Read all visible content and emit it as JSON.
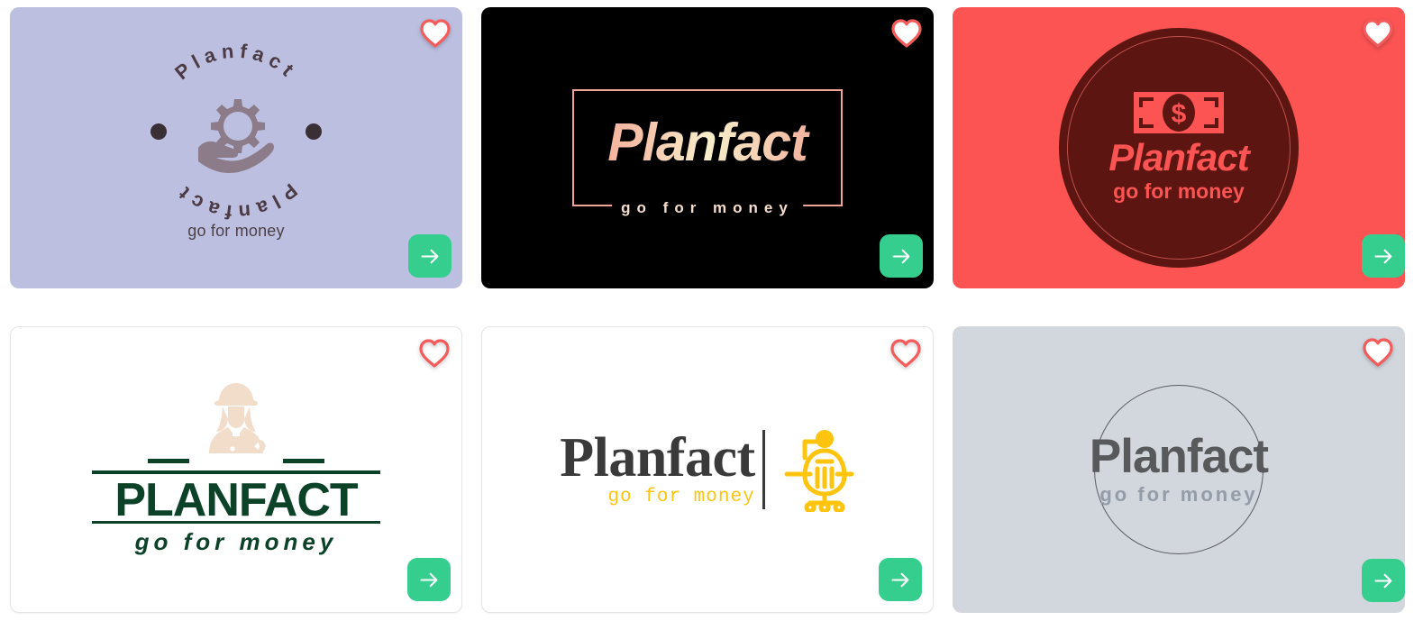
{
  "page": {
    "background": "#ffffff",
    "accent_green": "#36ce8f",
    "heart_stroke": "#f45b5b"
  },
  "controls": {
    "favorite_label": "heart-icon",
    "next_label": "arrow-right-icon"
  },
  "cards": [
    {
      "id": "card-circular-gear",
      "brand": "Planfact",
      "tagline": "go for money",
      "background": "#bcbfe0",
      "text_color": "#4c4149",
      "icon": "gear-in-hand-icon",
      "favorited": true,
      "arc_top_text": "Planfact",
      "arc_bottom_text": "Planfact"
    },
    {
      "id": "card-black-gradient-frame",
      "brand": "Planfact",
      "tagline": "go for money",
      "background": "#000000",
      "text_color": "#f6ddcb",
      "frame_color": "#f0a495",
      "icon": "rectangle-frame",
      "favorited": true
    },
    {
      "id": "card-coral-badge",
      "brand": "Planfact",
      "tagline": "go for money",
      "background": "#fb5453",
      "disc_color": "#5d1512",
      "text_color": "#fb5453",
      "icon": "banknote-dollar-icon",
      "favorited": true
    },
    {
      "id": "card-green-worker",
      "brand": "PLANFACT",
      "tagline": "go for money",
      "background": "#ffffff",
      "text_color": "#0c4228",
      "icon": "worker-helmet-wrench-icon",
      "favorited": false
    },
    {
      "id": "card-serif-chair",
      "brand": "Planfact",
      "tagline": "go for money",
      "background": "#ffffff",
      "text_color": "#3a3a3a",
      "tagline_color": "#ffc40d",
      "icon": "office-chair-person-icon",
      "favorited": false
    },
    {
      "id": "card-gray-ring",
      "brand": "Planfact",
      "tagline": "go for money",
      "background": "#d2d6dd",
      "text_color": "#58595b",
      "tagline_color": "#939ca8",
      "icon": "circle-outline",
      "favorited": true
    }
  ]
}
